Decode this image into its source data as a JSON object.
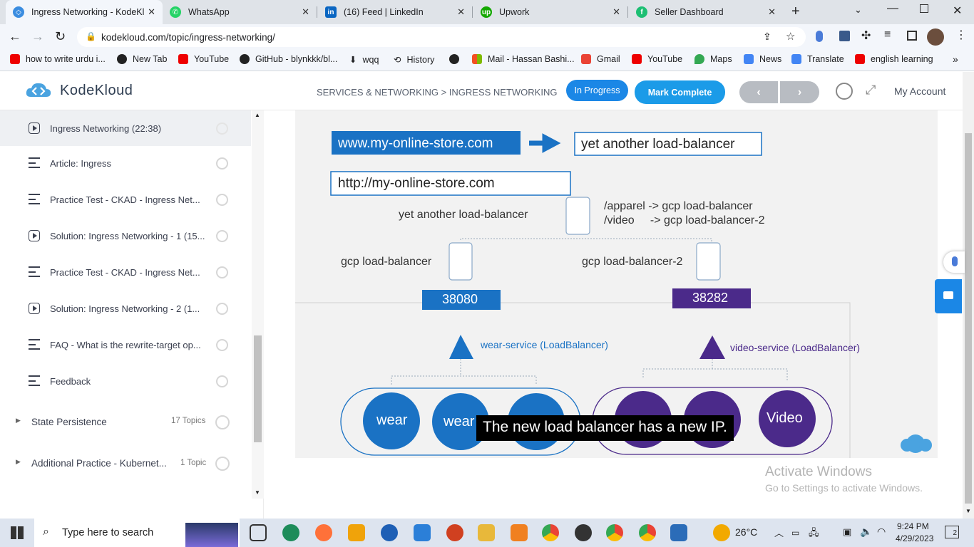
{
  "browser": {
    "tabs": [
      {
        "title": "Ingress Networking - KodeKl",
        "icon": "kodekloud-icon",
        "color": "#3b8de0",
        "active": true
      },
      {
        "title": "WhatsApp",
        "icon": "whatsapp-icon",
        "color": "#25d366",
        "active": false
      },
      {
        "title": "(16) Feed | LinkedIn",
        "icon": "linkedin-icon",
        "color": "#0a66c2",
        "active": false
      },
      {
        "title": "Upwork",
        "icon": "upwork-icon",
        "color": "#14a800",
        "active": false
      },
      {
        "title": "Seller Dashboard",
        "icon": "fiverr-icon",
        "color": "#1dbf73",
        "active": false
      }
    ],
    "url": "kodekloud.com/topic/ingress-networking/",
    "bookmarks": [
      {
        "label": "how to write urdu i...",
        "icon": "youtube-icon"
      },
      {
        "label": "New Tab",
        "icon": "globe-icon"
      },
      {
        "label": "YouTube",
        "icon": "youtube-icon"
      },
      {
        "label": "GitHub - blynkkk/bl...",
        "icon": "github-icon"
      },
      {
        "label": "wqq",
        "icon": "download-icon"
      },
      {
        "label": "History",
        "icon": "history-icon"
      },
      {
        "label": "",
        "icon": "globe-icon"
      },
      {
        "label": "Mail - Hassan Bashi...",
        "icon": "microsoft-icon"
      },
      {
        "label": "Gmail",
        "icon": "gmail-icon"
      },
      {
        "label": "YouTube",
        "icon": "youtube-icon"
      },
      {
        "label": "Maps",
        "icon": "maps-icon"
      },
      {
        "label": "News",
        "icon": "news-icon"
      },
      {
        "label": "Translate",
        "icon": "translate-icon"
      },
      {
        "label": "english learning",
        "icon": "youtube-icon"
      }
    ]
  },
  "header": {
    "logo": "KodeKloud",
    "breadcrumb": "SERVICES & NETWORKING > INGRESS NETWORKING",
    "status": "In Progress",
    "mark_complete": "Mark Complete",
    "my_account": "My Account"
  },
  "sidebar": {
    "lessons": [
      {
        "title": "Ingress Networking (22:38)",
        "type": "video",
        "current": true
      },
      {
        "title": "Article: Ingress",
        "type": "text"
      },
      {
        "title": "Practice Test - CKAD - Ingress Net...",
        "type": "text"
      },
      {
        "title": "Solution: Ingress Networking - 1 (15...",
        "type": "video"
      },
      {
        "title": "Practice Test - CKAD - Ingress Net...",
        "type": "text"
      },
      {
        "title": "Solution: Ingress Networking - 2 (1...",
        "type": "video"
      },
      {
        "title": "FAQ - What is the rewrite-target op...",
        "type": "text"
      },
      {
        "title": "Feedback",
        "type": "text"
      }
    ],
    "sections": [
      {
        "title": "State Persistence",
        "count": "17 Topics"
      },
      {
        "title": "Additional Practice - Kubernet...",
        "count": "1 Topic"
      }
    ]
  },
  "slide": {
    "domain_www": "www.my-online-store.com",
    "lb_box": "yet another load-balancer",
    "domain_http": "http://my-online-store.com",
    "lb_label": "yet another load-balancer",
    "rule1": "/apparel -> gcp load-balancer",
    "rule2": "/video     -> gcp load-balancer-2",
    "gcp1": "gcp load-balancer",
    "gcp2": "gcp load-balancer-2",
    "port1": "38080",
    "port2": "38282",
    "svc1": "wear-service (LoadBalancer)",
    "svc2": "video-service (LoadBalancer)",
    "pod_wear": "wear",
    "pod_video": "Video",
    "caption": "The new load balancer has a new IP.",
    "colors": {
      "wear": "#1a72c4",
      "video": "#4b2a8a"
    }
  },
  "watermark": {
    "line1": "Activate Windows",
    "line2": "Go to Settings to activate Windows."
  },
  "taskbar": {
    "search_placeholder": "Type here to search",
    "weather": "26°C",
    "time": "9:24 PM",
    "date": "4/29/2023",
    "notifications": "2"
  }
}
